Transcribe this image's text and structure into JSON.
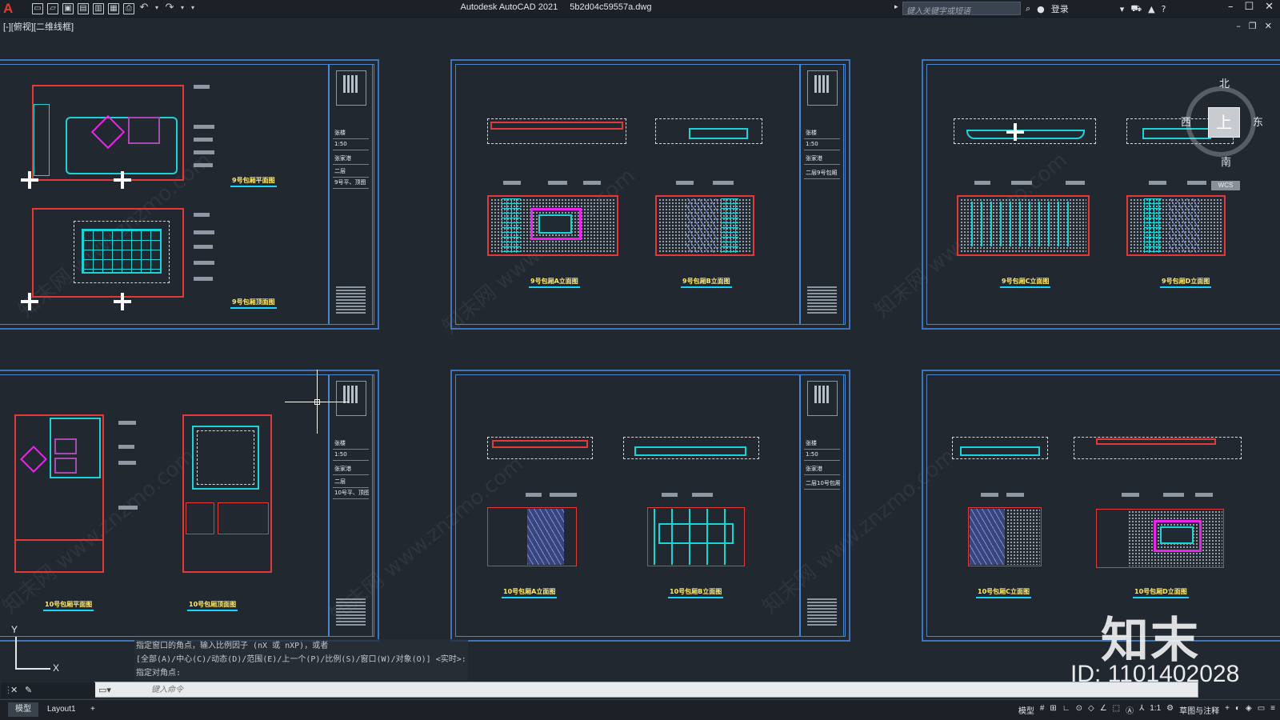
{
  "app": {
    "title": "Autodesk AutoCAD 2021",
    "file": "5b2d04c59557a.dwg",
    "logo": "A",
    "search_placeholder": "键入关键字或短语",
    "login": "登录",
    "view_label": "[-][俯视][二维线框]"
  },
  "qat_icons": [
    "new-icon",
    "open-icon",
    "save-icon",
    "saveas-icon",
    "plot-preview-icon",
    "publish-icon",
    "print-icon",
    "undo-icon",
    "redo-icon",
    "customize-icon"
  ],
  "viewcube": {
    "north": "北",
    "south": "南",
    "east": "东",
    "west": "西",
    "face": "上",
    "wcs": "WCS"
  },
  "sheets": [
    {
      "tb": [
        "张楼",
        "1:50",
        "张家港",
        "二层",
        "9号平、顶图"
      ],
      "captions": [
        "9号包厢平面图",
        "9号包厢顶面图"
      ]
    },
    {
      "tb": [
        "张楼",
        "1:50",
        "张家港",
        "二层9号包厢",
        ""
      ],
      "captions": [
        "9号包厢A立面图",
        "9号包厢B立面图"
      ]
    },
    {
      "tb": [],
      "captions": [
        "9号包厢C立面图",
        "9号包厢D立面图"
      ]
    },
    {
      "tb": [
        "张楼",
        "1:50",
        "张家港",
        "二层",
        "10号平、顶图"
      ],
      "captions": [
        "10号包厢平面图",
        "10号包厢顶面图"
      ]
    },
    {
      "tb": [
        "张楼",
        "1:50",
        "张家港",
        "二层10号包厢",
        ""
      ],
      "captions": [
        "10号包厢A立面图",
        "10号包厢B立面图"
      ]
    },
    {
      "tb": [],
      "captions": [
        "10号包厢C立面图",
        "10号包厢D立面图"
      ]
    }
  ],
  "command": {
    "history": [
      "指定窗口的角点，输入比例因子 (nX 或 nXP)，或者",
      "[全部(A)/中心(C)/动态(D)/范围(E)/上一个(P)/比例(S)/窗口(W)/对象(O)] <实时>:",
      "指定对角点:"
    ],
    "placeholder": "键入命令"
  },
  "ucs": {
    "x": "X",
    "y": "Y"
  },
  "tabs": {
    "model": "模型",
    "layout1": "Layout1",
    "add": "+"
  },
  "status": {
    "model": "模型",
    "scale": "1:1",
    "workspace": "草图与注释"
  },
  "watermark": {
    "brand": "知末",
    "id": "ID: 1101402028",
    "tile": "知末网 www.znzmo.com"
  },
  "colors": {
    "background": "#212830",
    "frame": "#4a86d0",
    "wall": "#e23a3a",
    "fixture": "#1ed3d8",
    "caption": "#ffe96a",
    "highlight": "#ee22ee"
  }
}
